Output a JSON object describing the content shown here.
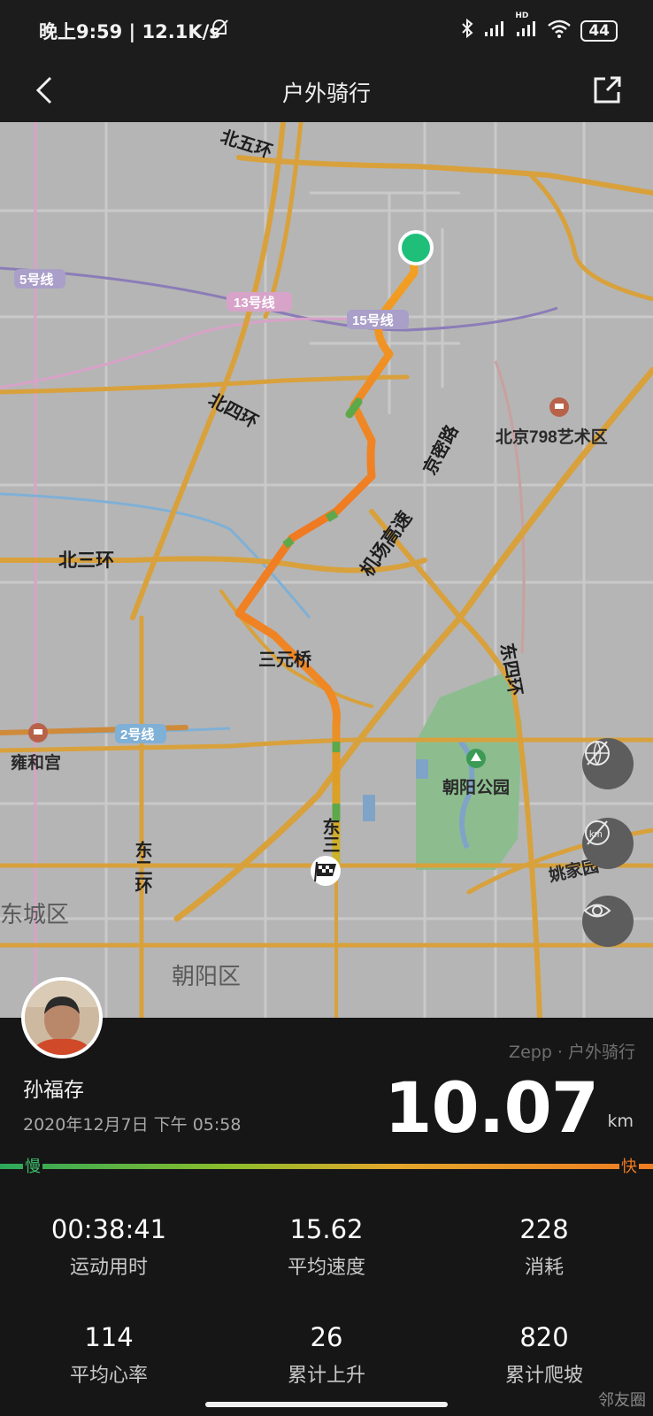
{
  "status_bar": {
    "left_text": "晚上9:59 | 12.1K/s",
    "hd_label": "HD",
    "battery": "44"
  },
  "nav": {
    "title": "户外骑行"
  },
  "map": {
    "labels": {
      "north_5th_ring": "北五环",
      "line_5": "5号线",
      "line_13": "13号线",
      "line_15": "15号线",
      "north_4th_ring": "北四环",
      "jingmi_road": "京密路",
      "art_district_798": "北京798艺术区",
      "airport_expressway": "机场高速",
      "north_3rd_ring": "北三环",
      "sanyuan_bridge": "三元桥",
      "east_4th_ring": "东四环",
      "line_2": "2号线",
      "yonghe_temple": "雍和宫",
      "chaoyang_park": "朝阳公园",
      "east_2nd_ring": "东二环",
      "dongcheng_district": "东城区",
      "chaoyang_district": "朝阳区",
      "yaojiayuan": "姚家园",
      "east_3rd_ring_fragment": "东三"
    }
  },
  "workout": {
    "user_name": "孙福存",
    "date": "2020年12月7日 下午 05:58",
    "source": "Zepp · 户外骑行",
    "distance": "10.07",
    "distance_unit": "km",
    "speed_legend": {
      "slow": "慢",
      "fast": "快"
    },
    "stats": [
      {
        "value": "00:38:41",
        "label": "运动用时"
      },
      {
        "value": "15.62",
        "label": "平均速度"
      },
      {
        "value": "228",
        "label": "消耗"
      },
      {
        "value": "114",
        "label": "平均心率"
      },
      {
        "value": "26",
        "label": "累计上升"
      },
      {
        "value": "820",
        "label": "累计爬坡"
      }
    ]
  },
  "watermark": "邻友圈",
  "colors": {
    "route_fast": "#f07a22",
    "route_slow": "#2ca85b",
    "start_marker": "#1fbf7a",
    "road_major": "#d9a13c",
    "map_background": "#b5b5b5"
  }
}
